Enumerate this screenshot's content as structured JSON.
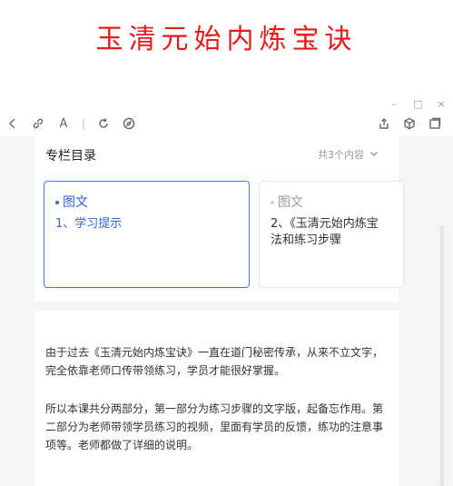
{
  "banner": {
    "title": "玉清元始内炼宝诀"
  },
  "window": {
    "minimize": "–",
    "maximize": "□",
    "close": "×"
  },
  "toolbar": {
    "left_icons": [
      "back-chevron-icon",
      "link-icon",
      "font-size-icon",
      "refresh-icon",
      "compass-icon"
    ],
    "right_icons": [
      "share-icon",
      "cube-icon",
      "window-icon"
    ],
    "font_glyph": "A",
    "separator": "|"
  },
  "catalog": {
    "title": "专栏目录",
    "count": "共3个内容"
  },
  "items": [
    {
      "type": "图文",
      "title": "1、学习提示",
      "active": true
    },
    {
      "type": "图文",
      "title": "2、《玉清元始内炼宝 法和练习步骤",
      "active": false
    }
  ],
  "article": {
    "paragraphs": [
      "由于过去《玉清元始内炼宝诀》一直在道门秘密传承，从来不立文字，完全依靠老师口传带领练习，学员才能很好掌握。",
      "所以本课共分两部分，第一部分为练习步骤的文字版，起备忘作用。第二部分为老师带领学员练习的视频，里面有学员的反馈，练功的注意事项等。老师都做了详细的说明。"
    ]
  },
  "colors": {
    "banner": "#e41b1b",
    "accent": "#2f66d6"
  }
}
